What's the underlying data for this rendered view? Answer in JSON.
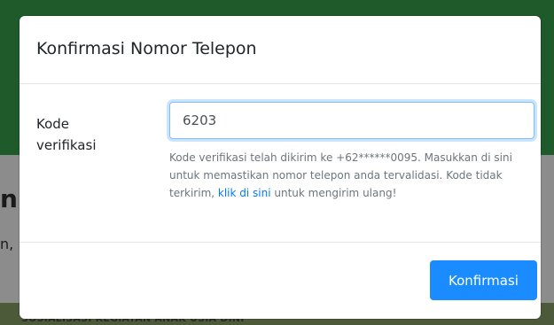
{
  "background": {
    "left_heading_fragment": "n",
    "left_text_fragment": "n,",
    "bottom_strip_text": "SOSIALISASI KEGIATAN ANAK USIA DINI"
  },
  "modal": {
    "title": "Konfirmasi Nomor Telepon",
    "field_label": "Kode verifikasi",
    "field_value": "6203",
    "help_text_part1": "Kode verifikasi telah dikirim ke +62******0095. Masukkan di sini untuk memastikan nomor telepon anda tervalidasi. Kode tidak terkirim, ",
    "help_link": "klik di sini",
    "help_text_part2": " untuk mengirim ulang!",
    "confirm_button": "Konfirmasi"
  },
  "colors": {
    "primary": "#007bff",
    "button": "#1a8cff",
    "input_focus_border": "#80bdff"
  }
}
